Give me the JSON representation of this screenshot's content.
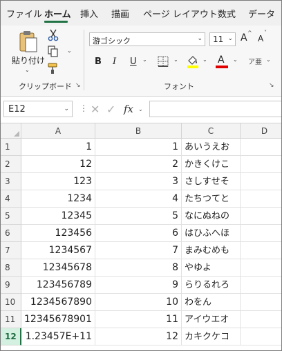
{
  "ribbon_tabs": [
    {
      "label": "ファイル",
      "active": false
    },
    {
      "label": "ホーム",
      "active": true
    },
    {
      "label": "挿入",
      "active": false
    },
    {
      "label": "描画",
      "active": false
    },
    {
      "label": "ページ レイアウト",
      "active": false
    },
    {
      "label": "数式",
      "active": false
    },
    {
      "label": "データ",
      "active": false
    }
  ],
  "clipboard": {
    "paste_label": "貼り付け",
    "group_label": "クリップボード",
    "icons": [
      "paste-icon",
      "cut-icon",
      "copy-icon",
      "format-painter-icon"
    ]
  },
  "font": {
    "font_name": "游ゴシック",
    "font_size": "11",
    "group_label": "フォント",
    "bold": "B",
    "italic": "I",
    "underline": "U",
    "grow_font": "A",
    "shrink_font": "A",
    "font_color_letter": "A",
    "phonetic_label": "ア亜",
    "highlight_color": "#ffff00",
    "font_color": "#e00000"
  },
  "formula_bar": {
    "name_box": "E12",
    "fx_label": "fx",
    "formula": ""
  },
  "sheet": {
    "columns": [
      "A",
      "B",
      "C",
      "D"
    ],
    "selected_row": 12,
    "selected_cell": "E12",
    "rows": [
      {
        "row": "1",
        "a": "1",
        "b": "1",
        "c": "あいうえお"
      },
      {
        "row": "2",
        "a": "12",
        "b": "2",
        "c": "かきくけこ"
      },
      {
        "row": "3",
        "a": "123",
        "b": "3",
        "c": "さしすせそ"
      },
      {
        "row": "4",
        "a": "1234",
        "b": "4",
        "c": "たちつてと"
      },
      {
        "row": "5",
        "a": "12345",
        "b": "5",
        "c": "なにぬねの"
      },
      {
        "row": "6",
        "a": "123456",
        "b": "6",
        "c": "はひふへほ"
      },
      {
        "row": "7",
        "a": "1234567",
        "b": "7",
        "c": "まみむめも"
      },
      {
        "row": "8",
        "a": "12345678",
        "b": "8",
        "c": "やゆよ"
      },
      {
        "row": "9",
        "a": "123456789",
        "b": "9",
        "c": "らりるれろ"
      },
      {
        "row": "10",
        "a": "1234567890",
        "b": "10",
        "c": "わをん"
      },
      {
        "row": "11",
        "a": "12345678901",
        "b": "11",
        "c": "アイウエオ"
      },
      {
        "row": "12",
        "a": "1.23457E+11",
        "b": "12",
        "c": "カキクケコ"
      }
    ]
  },
  "accent_color": "#217346"
}
